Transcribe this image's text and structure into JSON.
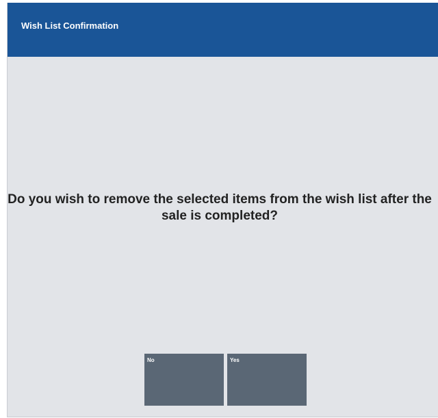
{
  "dialog": {
    "title": "Wish List Confirmation",
    "message": "Do you wish to remove the selected items from the wish list after the sale is completed?",
    "buttons": {
      "no_label": "No",
      "yes_label": "Yes"
    }
  },
  "colors": {
    "title_bar": "#1a5597",
    "body_background": "#e2e4e8",
    "button_background": "#5a6775",
    "title_text": "#ffffff",
    "message_text": "#222222"
  }
}
